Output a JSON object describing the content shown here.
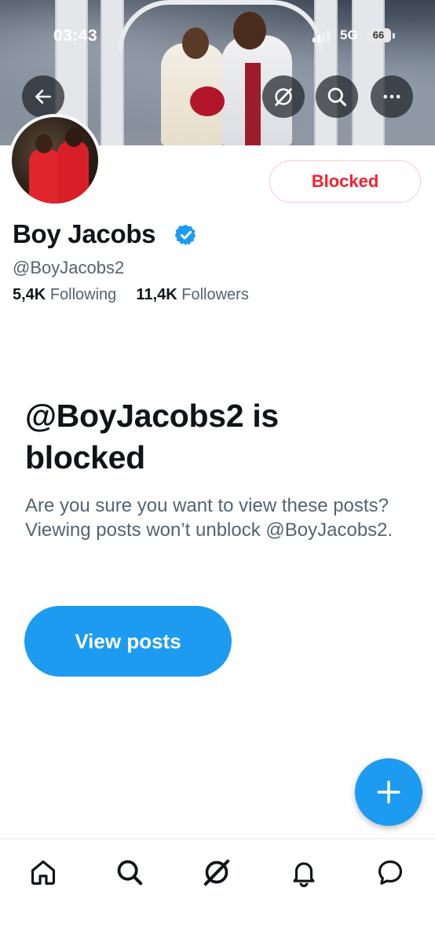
{
  "status_bar": {
    "time": "03:43",
    "network": "5G",
    "battery": "66"
  },
  "header": {
    "back_icon": "arrow-left-icon",
    "grok_icon": "grok-icon",
    "search_icon": "search-icon",
    "more_icon": "more-horizontal-icon"
  },
  "profile": {
    "name": "Boy Jacobs",
    "verified": true,
    "handle": "@BoyJacobs2",
    "following_count": "5,4K",
    "following_label": "Following",
    "followers_count": "11,4K",
    "followers_label": "Followers",
    "blocked_button_label": "Blocked"
  },
  "blocked_notice": {
    "title": "@BoyJacobs2 is blocked",
    "description": "Are you sure you want to view these posts? Viewing posts won’t unblock @BoyJacobs2.",
    "view_button_label": "View posts"
  },
  "fab": {
    "icon": "plus-icon"
  },
  "tab_bar": {
    "items": [
      {
        "name": "home",
        "icon": "home-icon"
      },
      {
        "name": "search",
        "icon": "search-icon"
      },
      {
        "name": "grok",
        "icon": "grok-icon"
      },
      {
        "name": "notifications",
        "icon": "bell-icon"
      },
      {
        "name": "messages",
        "icon": "chat-bubble-icon"
      }
    ]
  },
  "colors": {
    "accent": "#1d9bf0",
    "blocked_red": "#f4212e",
    "text_primary": "#0f1419",
    "text_secondary": "#536471"
  }
}
